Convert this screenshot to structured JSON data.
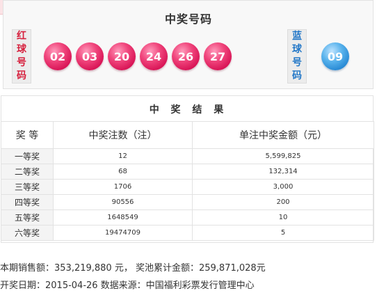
{
  "winning": {
    "title": "中奖号码",
    "red_label": [
      "红",
      "球",
      "号",
      "码"
    ],
    "blue_label": [
      "蓝",
      "球",
      "号",
      "码"
    ],
    "red_balls": [
      "02",
      "03",
      "20",
      "24",
      "26",
      "27"
    ],
    "blue_ball": "09"
  },
  "results": {
    "title": "中 奖 结 果",
    "headers": [
      "奖 等",
      "中奖注数（注）",
      "单注中奖金额（元）"
    ],
    "rows": [
      [
        "一等奖",
        "12",
        "5,599,825"
      ],
      [
        "二等奖",
        "68",
        "132,314"
      ],
      [
        "三等奖",
        "1706",
        "3,000"
      ],
      [
        "四等奖",
        "90556",
        "200"
      ],
      [
        "五等奖",
        "1648549",
        "10"
      ],
      [
        "六等奖",
        "19474709",
        "5"
      ]
    ]
  },
  "footer": {
    "sales_line": "本期销售额：353,219,880 元， 奖池累计金额：259,871,028元",
    "date_line": "开奖日期：2015-04-26 数据来源：中国福利彩票发行管理中心"
  },
  "colors": {
    "red_ball": "#e0306a",
    "blue_ball": "#2c8fd8",
    "red_text": "#d6213e",
    "blue_text": "#2478c8"
  }
}
